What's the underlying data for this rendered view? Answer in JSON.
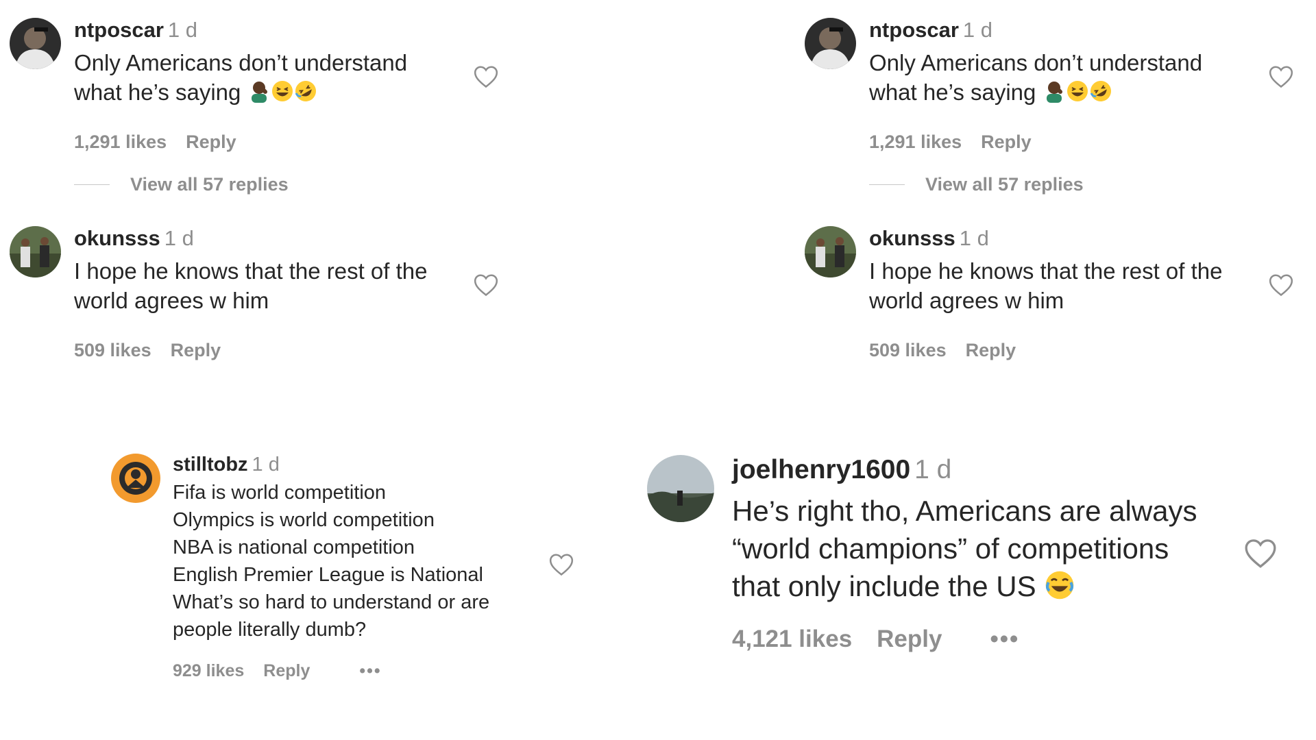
{
  "panel_left": {
    "c1": {
      "username": "ntposcar",
      "time": "1 d",
      "text": "Only Americans don’t understand\nwhat he’s saying",
      "emojis": [
        "man-facepalming-icon",
        "grinning-squinting-face-icon",
        "rolling-on-floor-laughing-icon"
      ],
      "likes": "1,291 likes",
      "reply": "Reply",
      "view_replies": "View all 57 replies"
    },
    "c2": {
      "username": "okunsss",
      "time": "1 d",
      "text": "I hope he knows that the rest of the\nworld agrees w him",
      "likes": "509 likes",
      "reply": "Reply"
    }
  },
  "panel_right": {
    "c1": {
      "username": "ntposcar",
      "time": "1 d",
      "text": "Only Americans don’t understand\nwhat he’s saying",
      "likes": "1,291 likes",
      "reply": "Reply",
      "view_replies": "View all 57 replies"
    },
    "c2": {
      "username": "okunsss",
      "time": "1 d",
      "text": "I hope he knows that the rest of the\nworld agrees w him",
      "likes": "509 likes",
      "reply": "Reply"
    }
  },
  "comment_stilltobz": {
    "username": "stilltobz",
    "time": "1 d",
    "text": "Fifa is world competition\nOlympics is world competition\nNBA is national competition\nEnglish Premier League is National\nWhat’s so hard to understand or are\npeople literally dumb?",
    "likes": "929 likes",
    "reply": "Reply",
    "more": "•••"
  },
  "comment_joelhenry": {
    "username": "joelhenry1600",
    "time": "1 d",
    "text": "He’s right tho, Americans are always\n“world champions” of competitions\nthat only include the US",
    "emoji": "face-with-tears-of-joy-icon",
    "likes": "4,121 likes",
    "reply": "Reply",
    "more": "•••"
  },
  "colors": {
    "text": "#262626",
    "secondary": "#8e8e8e",
    "divider": "#c7c7c7",
    "emoji_yellow": "#ffcc33"
  }
}
